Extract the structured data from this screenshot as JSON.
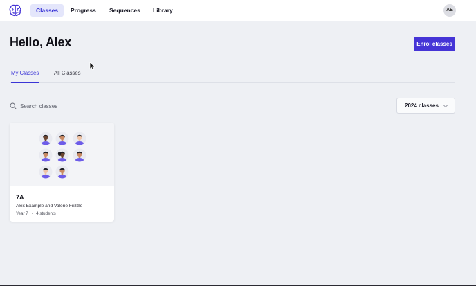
{
  "nav": {
    "items": [
      {
        "label": "Classes",
        "active": true
      },
      {
        "label": "Progress",
        "active": false
      },
      {
        "label": "Sequences",
        "active": false
      },
      {
        "label": "Library",
        "active": false
      }
    ],
    "avatar_initials": "AE",
    "logo_icon": "brain-icon"
  },
  "header": {
    "greeting": "Hello, Alex",
    "enrol_label": "Enrol classes"
  },
  "tabs": [
    {
      "label": "My Classes",
      "active": true
    },
    {
      "label": "All Classes",
      "active": false
    }
  ],
  "search": {
    "placeholder": "Search classes",
    "value": ""
  },
  "year_filter": {
    "selected": "2024 classes"
  },
  "classes": [
    {
      "name": "7A",
      "teachers": "Alex Example and Valerie Frizzle",
      "year": "Year 7",
      "separator": "·",
      "students": "4 students"
    }
  ],
  "colors": {
    "accent": "#4534d6",
    "accent_text": "#3b35d6",
    "nav_active_bg": "#e4e6fb",
    "page_bg": "#eef0f4",
    "student_shirt": "#6d5ce8"
  }
}
